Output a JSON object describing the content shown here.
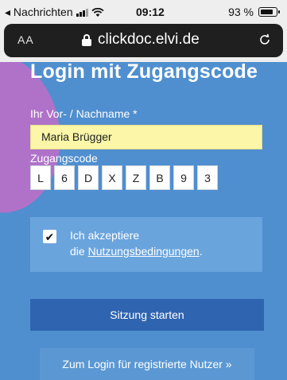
{
  "status_bar": {
    "back_app": "◂ Nachrichten",
    "time": "09:12",
    "battery": "93 %"
  },
  "browser": {
    "text_size": "AA",
    "domain": "clickdoc.elvi.de"
  },
  "page": {
    "title": "Login mit Zugangscode",
    "name_label": "Ihr Vor- / Nachname *",
    "name_value": "Maria Brügger",
    "code_label": "Zugangscode",
    "code_chars": [
      "L",
      "6",
      "D",
      "X",
      "Z",
      "B",
      "9",
      "3"
    ],
    "terms_checked": true,
    "terms_line1": "Ich akzeptiere",
    "terms_line2_prefix": "die ",
    "terms_link": "Nutzungsbedingungen",
    "terms_line2_suffix": ".",
    "start_button": "Sitzung starten",
    "registered_button": "Zum Login für registrierte Nutzer »"
  },
  "colors": {
    "page_bg": "#4f8fcf",
    "accent_blob": "#b072c9",
    "name_field_bg": "#fbf6a8",
    "primary_button": "#2f64b0"
  }
}
